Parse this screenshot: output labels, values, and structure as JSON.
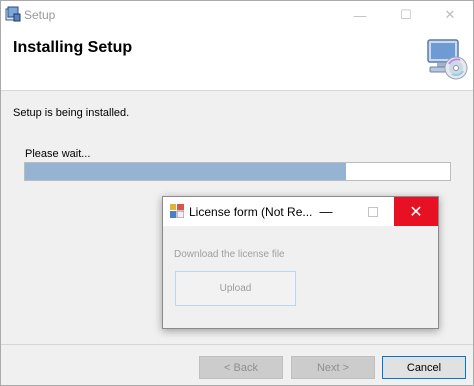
{
  "window": {
    "title": "Setup",
    "minimize_glyph": "—",
    "maximize_glyph": "☐",
    "close_glyph": "✕",
    "icon": "setup-app-icon"
  },
  "header": {
    "title": "Installing Setup",
    "graphic": "computer-cd-icon"
  },
  "body": {
    "status": "Setup is being installed.",
    "wait_label": "Please wait...",
    "progress_fraction": 0.755
  },
  "footer": {
    "back_label": "< Back",
    "next_label": "Next >",
    "cancel_label": "Cancel"
  },
  "modal": {
    "title": "License form (Not Re...",
    "minimize_glyph": "—",
    "close_glyph": "✕",
    "icon": "form-app-icon",
    "hint": "Download the license file",
    "upload_label": "Upload",
    "close_color": "#e81123"
  },
  "colors": {
    "progress_fill": "#95b3d3",
    "default_button_border": "#0078d7"
  }
}
